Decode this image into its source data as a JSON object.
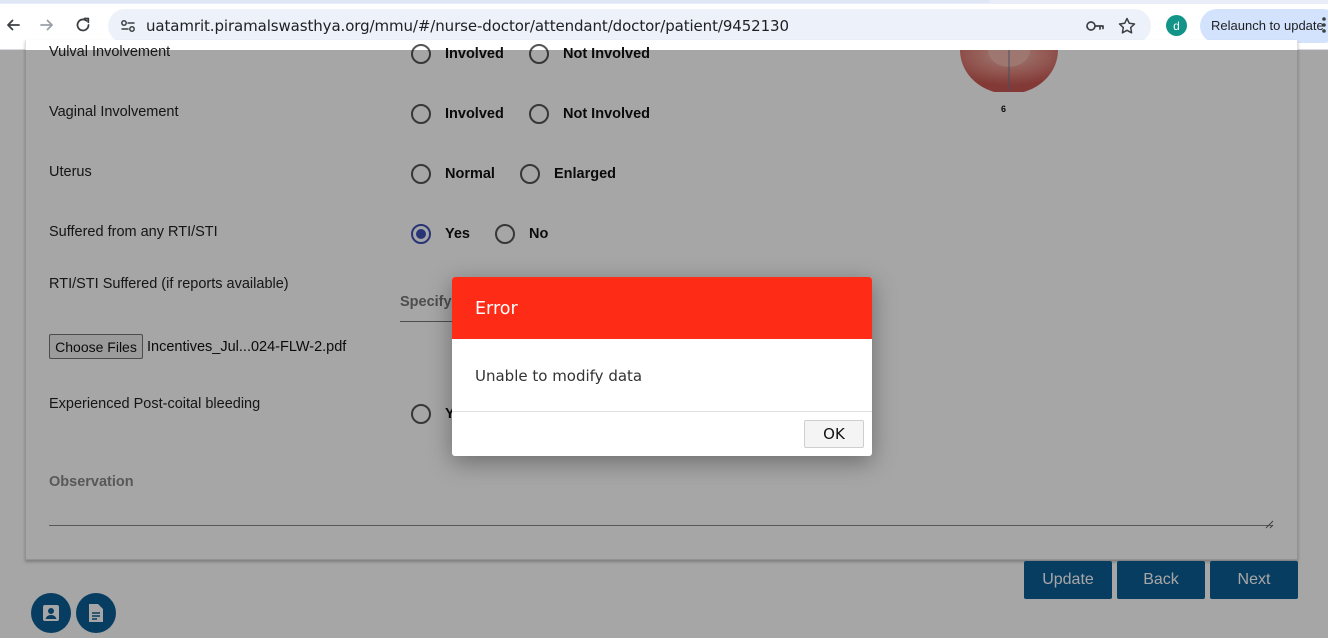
{
  "browser": {
    "url": "uatamrit.piramalswasthya.org/mmu/#/nurse-doctor/attendant/doctor/patient/9452130",
    "profile_initial": "d",
    "relaunch_label": "Relaunch to update"
  },
  "form": {
    "rows": [
      {
        "label": "Vulval Involvement",
        "options": [
          "Involved",
          "Not Involved"
        ],
        "selected": null
      },
      {
        "label": "Vaginal Involvement",
        "options": [
          "Involved",
          "Not Involved"
        ],
        "selected": null
      },
      {
        "label": "Uterus",
        "options": [
          "Normal",
          "Enlarged"
        ],
        "selected": null
      },
      {
        "label": "Suffered from any RTI/STI",
        "options": [
          "Yes",
          "No"
        ],
        "selected": "Yes"
      }
    ],
    "rti_label": "RTI/STI Suffered (if reports available)",
    "specify_placeholder": "Specify",
    "choose_files_label": "Choose Files",
    "file_name": "Incentives_Jul...024-FLW-2.pdf",
    "postcoital_label": "Experienced Post-coital bleeding",
    "postcoital_option_partial": "Y",
    "observation_label": "Observation",
    "diagram_number": "6"
  },
  "actions": {
    "update": "Update",
    "back": "Back",
    "next": "Next"
  },
  "dialog": {
    "title": "Error",
    "message": "Unable to modify data",
    "ok": "OK"
  },
  "colors": {
    "primary": "#0c5e96",
    "error_header": "#fe2c17",
    "radio_checked": "#3f51b5"
  }
}
